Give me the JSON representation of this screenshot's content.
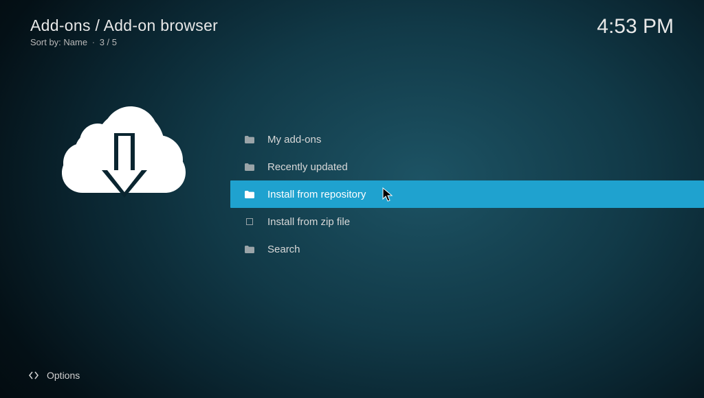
{
  "header": {
    "breadcrumb": "Add-ons / Add-on browser",
    "sort_label": "Sort by:",
    "sort_value": "Name",
    "position": "3 / 5"
  },
  "clock": "4:53 PM",
  "menu": {
    "items": [
      {
        "label": "My add-ons",
        "icon": "folder",
        "selected": false
      },
      {
        "label": "Recently updated",
        "icon": "folder",
        "selected": false
      },
      {
        "label": "Install from repository",
        "icon": "folder",
        "selected": true
      },
      {
        "label": "Install from zip file",
        "icon": "box",
        "selected": false
      },
      {
        "label": "Search",
        "icon": "folder",
        "selected": false
      }
    ]
  },
  "footer": {
    "options_label": "Options"
  },
  "colors": {
    "highlight": "#1fa2cf",
    "text": "#e6e6e6"
  }
}
